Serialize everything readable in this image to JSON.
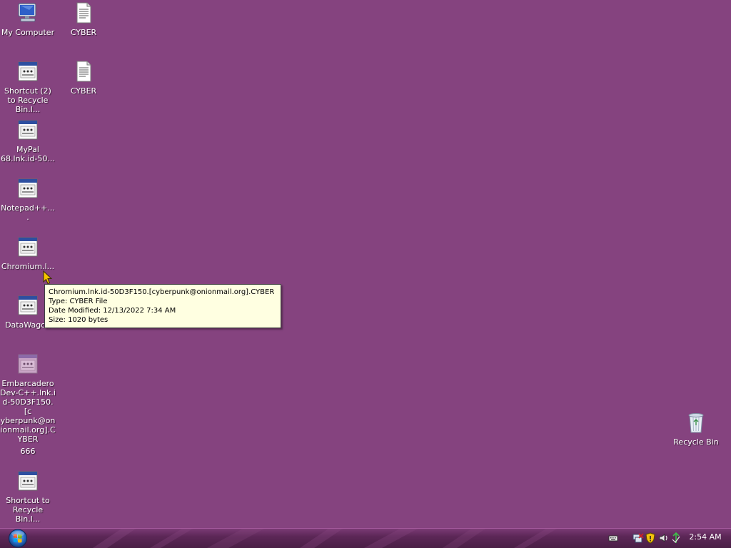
{
  "desktop": {
    "background_color": "#85437f",
    "icons": [
      {
        "label": "My Computer",
        "icon": "my-computer-icon"
      },
      {
        "label": "CYBER",
        "icon": "text-file-icon"
      },
      {
        "label": "Shortcut (2) to Recycle Bin.l...",
        "icon": "shortcut-file-icon"
      },
      {
        "label": "CYBER",
        "icon": "text-file-icon"
      },
      {
        "label": "MyPal 68.lnk.id-50...",
        "icon": "shortcut-file-icon"
      },
      {
        "label": "Notepad++....",
        "icon": "shortcut-file-icon"
      },
      {
        "label": "Chromium.l...",
        "icon": "shortcut-file-icon"
      },
      {
        "label": "DataWagon",
        "icon": "shortcut-file-icon"
      },
      {
        "label": "Embarcadero Dev-C++.lnk.i d-50D3F150.[c yberpunk@on ionmail.org].C YBER",
        "sublabel": "666",
        "icon": "shortcut-file-icon"
      },
      {
        "label": "Shortcut to Recycle Bin.l...",
        "icon": "shortcut-file-icon"
      },
      {
        "label": "Recycle Bin",
        "icon": "recycle-bin-icon"
      }
    ]
  },
  "tooltip": {
    "name": "Chromium.lnk.id-50D3F150.[cyberpunk@onionmail.org].CYBER",
    "type": "Type: CYBER File",
    "modified": "Date Modified: 12/13/2022 7:34 AM",
    "size": "Size: 1020 bytes"
  },
  "taskbar": {
    "start_button": "start-orb-icon",
    "tray_icons": [
      "keyboard-icon",
      "network-icon",
      "security-shield-icon",
      "volume-icon",
      "network-activity-icon"
    ],
    "clock": "2:54 AM"
  }
}
